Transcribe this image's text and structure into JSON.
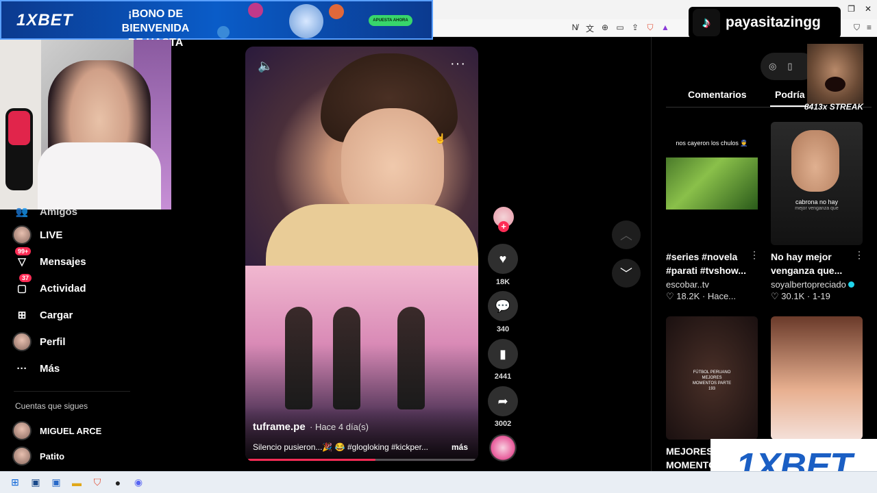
{
  "ad_top": {
    "logo": "1XBET",
    "line1": "¡BONO DE BIENVENIDA",
    "line2": "DE HASTA",
    "button": "APUESTA AHORA"
  },
  "tiktok_badge": {
    "username": "payasitazingg"
  },
  "meme": {
    "streak": "8413x STREAK"
  },
  "sidebar": {
    "items": [
      {
        "label": "Amigos",
        "icon": "friends-icon"
      },
      {
        "label": "LIVE",
        "icon": "live-avatar"
      },
      {
        "label": "Mensajes",
        "icon": "messages-icon",
        "badge": "99+"
      },
      {
        "label": "Actividad",
        "icon": "activity-icon",
        "badge": "37"
      },
      {
        "label": "Cargar",
        "icon": "upload-icon"
      },
      {
        "label": "Perfil",
        "icon": "profile-avatar"
      },
      {
        "label": "Más",
        "icon": "more-icon"
      }
    ],
    "following_title": "Cuentas que sigues",
    "following": [
      {
        "label": "MIGUEL ARCE"
      },
      {
        "label": "Patito"
      }
    ]
  },
  "video": {
    "author": "tuframe.pe",
    "time": "· Hace 4 día(s)",
    "description": "Silencio pusieron...🎉 😂 #glogloking #kickper...",
    "more": "más",
    "progress": 0.56
  },
  "actions": {
    "likes": "18K",
    "comments": "340",
    "saves": "2441",
    "shares": "3002"
  },
  "tabs": {
    "comments": "Comentarios",
    "might_like": "Podría i"
  },
  "cards": [
    {
      "thumb_caption": "nos cayeron los chulos 👮",
      "title": "#series #novela #parati #tvshow...",
      "user": "escobar..tv",
      "likes": "18.2K",
      "date": "Hace..."
    },
    {
      "thumb_caption": "cabrona no hay",
      "thumb_caption2": "mejor venganza que",
      "title": "No hay mejor venganza que...",
      "user": "soyalbertopreciado",
      "likes": "30.1K",
      "date": "1-19"
    },
    {
      "thumb_caption": "FÚTBOL PERUANO MEJORES MOMENTOS PARTE 193",
      "title": "MEJORES MOMENTO",
      "user": "",
      "likes": "",
      "date": ""
    },
    {
      "thumb_caption": "",
      "title": "",
      "user": "",
      "likes": "",
      "date": ""
    }
  ],
  "ad_bottom": {
    "logo": "1XBET"
  },
  "colors": {
    "accent": "#fe2c55",
    "brand_blue": "#1b5fc4"
  }
}
